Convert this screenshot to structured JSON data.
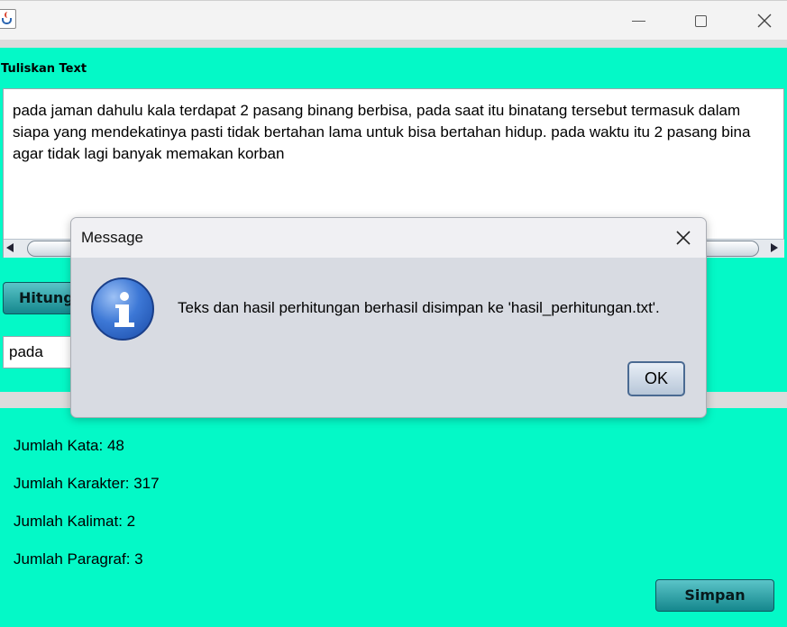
{
  "window": {
    "app_icon": "java-cup-icon",
    "controls": [
      "minimize-icon",
      "maximize-icon",
      "close-icon"
    ]
  },
  "input_panel": {
    "label": "Tuliskan Text",
    "text_lines": [
      "pada jaman dahulu kala terdapat 2 pasang binang berbisa, pada saat itu binatang tersebut termasuk dalam",
      "siapa yang mendekatinya pasti tidak bertahan lama untuk bisa bertahan hidup. pada waktu itu 2 pasang bina",
      "agar tidak lagi banyak memakan korban"
    ],
    "hitung_button": "Hitung",
    "search_value": "pada"
  },
  "results": {
    "jumlah_kata": "Jumlah Kata: 48",
    "jumlah_karakter": "Jumlah Karakter: 317",
    "jumlah_kalimat": "Jumlah Kalimat: 2",
    "jumlah_paragraf": "Jumlah Paragraf: 3",
    "simpan_button": "Simpan"
  },
  "dialog": {
    "title": "Message",
    "message": "Teks dan hasil perhitungan berhasil disimpan ke 'hasil_perhitungan.txt'.",
    "ok_button": "OK",
    "icon": "info-icon"
  },
  "colors": {
    "panel_bg": "#04f9c7",
    "button_teal": "#15878d",
    "dialog_bg": "#d8dbe2"
  }
}
